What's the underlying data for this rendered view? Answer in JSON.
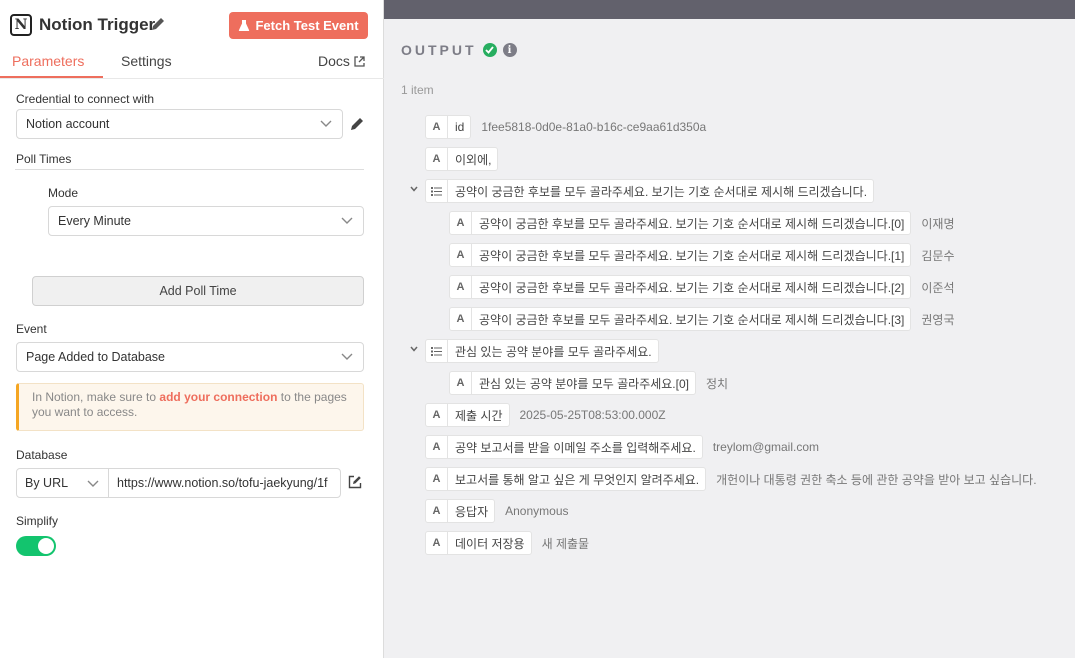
{
  "header": {
    "logo_glyph": "N",
    "title": "Notion Trigger",
    "fetch_button": "Fetch Test Event",
    "tabs": {
      "parameters": "Parameters",
      "settings": "Settings"
    },
    "docs": "Docs"
  },
  "params": {
    "credential_label": "Credential to connect with",
    "credential_value": "Notion account",
    "poll_times_label": "Poll Times",
    "mode_label": "Mode",
    "mode_value": "Every Minute",
    "add_poll_time": "Add Poll Time",
    "event_label": "Event",
    "event_value": "Page Added to Database",
    "notice_pre": "In Notion, make sure to ",
    "notice_link": "add your connection",
    "notice_post": " to the pages you want to access.",
    "database_label": "Database",
    "database_mode": "By URL",
    "database_url": "https://www.notion.so/tofu-jaekyung/1f",
    "simplify_label": "Simplify",
    "simplify_on": true
  },
  "output": {
    "title": "OUTPUT",
    "count": "1 item",
    "accent": "#27ae60",
    "rows": [
      {
        "type": "A",
        "key": "id",
        "value": "1fee5818-0d0e-81a0-b16c-ce9aa61d350a"
      },
      {
        "type": "A",
        "key": "이외에,",
        "value": ""
      },
      {
        "type": "list",
        "key": "공약이 궁금한 후보를 모두 골라주세요. 보기는 기호 순서대로 제시해 드리겠습니다.",
        "value": ""
      },
      {
        "type": "A",
        "key": "공약이 궁금한 후보를 모두 골라주세요. 보기는 기호 순서대로 제시해 드리겠습니다.[0]",
        "value": "이재명"
      },
      {
        "type": "A",
        "key": "공약이 궁금한 후보를 모두 골라주세요. 보기는 기호 순서대로 제시해 드리겠습니다.[1]",
        "value": "김문수"
      },
      {
        "type": "A",
        "key": "공약이 궁금한 후보를 모두 골라주세요. 보기는 기호 순서대로 제시해 드리겠습니다.[2]",
        "value": "이준석"
      },
      {
        "type": "A",
        "key": "공약이 궁금한 후보를 모두 골라주세요. 보기는 기호 순서대로 제시해 드리겠습니다.[3]",
        "value": "권영국"
      },
      {
        "type": "list",
        "key": "관심 있는 공약 분야를 모두 골라주세요.",
        "value": ""
      },
      {
        "type": "A",
        "key": "관심 있는 공약 분야를 모두 골라주세요.[0]",
        "value": "정치"
      },
      {
        "type": "A",
        "key": "제출 시간",
        "value": "2025-05-25T08:53:00.000Z"
      },
      {
        "type": "A",
        "key": "공약 보고서를 받을 이메일 주소를 입력해주세요.",
        "value": "treylom@gmail.com"
      },
      {
        "type": "A",
        "key": "보고서를 통해 알고 싶은 게 무엇인지 알려주세요.",
        "value": "개헌이나 대통령 권한 축소 등에 관한 공약을 받아 보고 싶습니다."
      },
      {
        "type": "A",
        "key": "응답자",
        "value": "Anonymous"
      },
      {
        "type": "A",
        "key": "데이터 저장용",
        "value": "새 제출물"
      }
    ]
  }
}
